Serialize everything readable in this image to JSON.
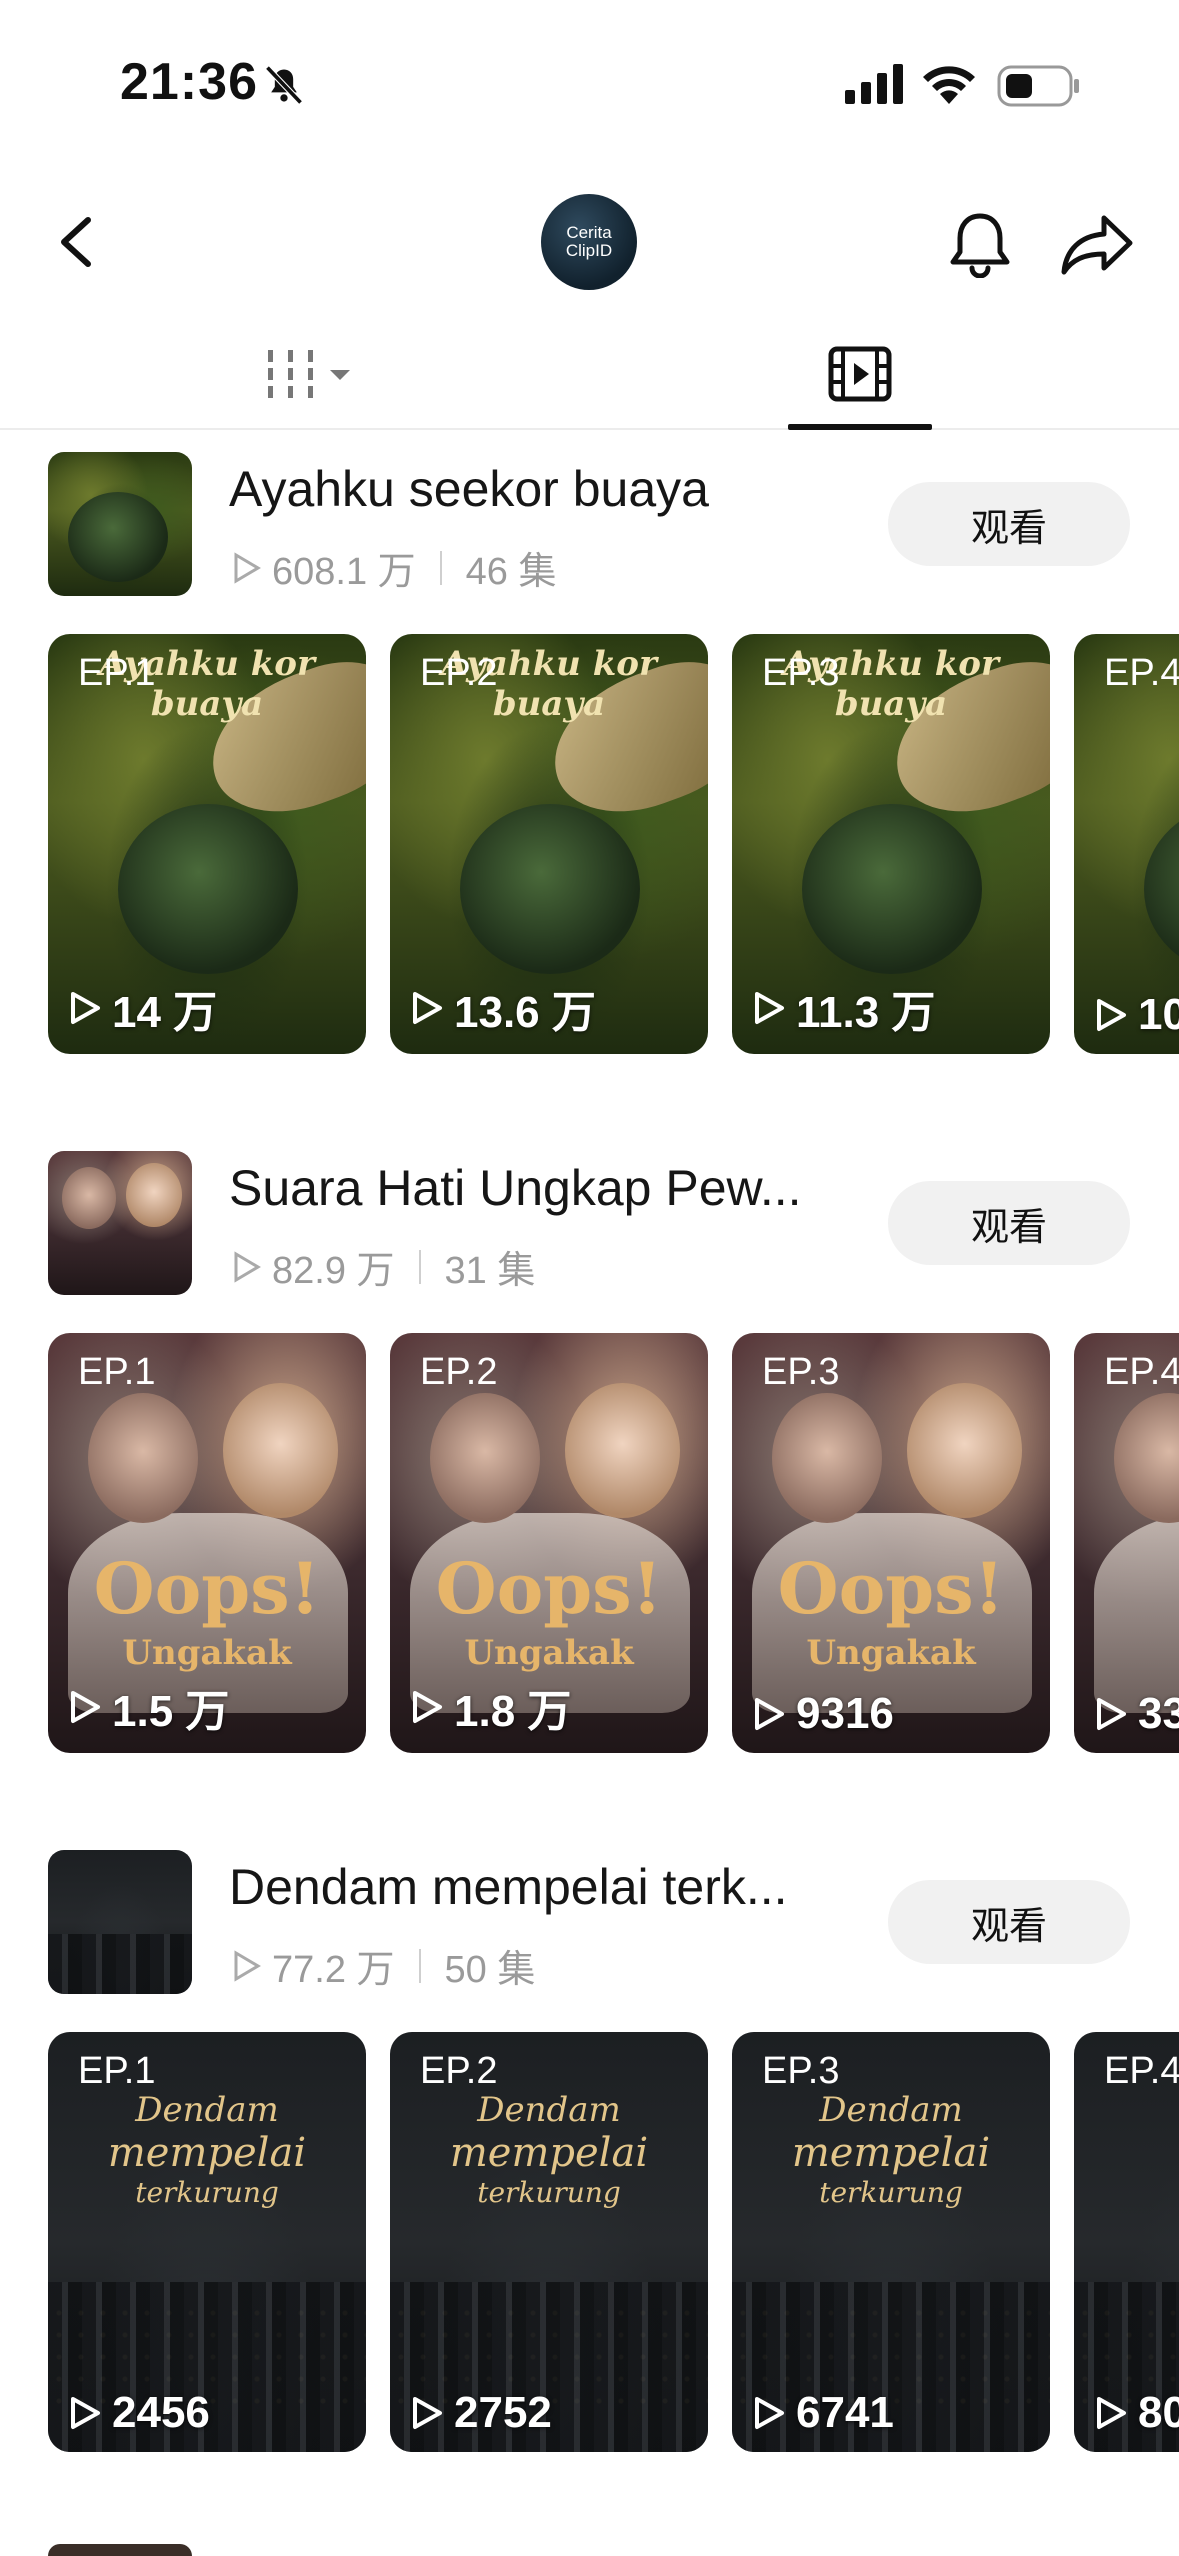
{
  "status_bar": {
    "time": "21:36",
    "icons": [
      "bell-slash-icon",
      "signal-icon",
      "wifi-icon",
      "battery-icon"
    ]
  },
  "header": {
    "avatar_text_1": "Cerita",
    "avatar_text_2": "ClipID",
    "icons": [
      "back-chevron-icon",
      "bell-icon",
      "share-arrow-icon"
    ]
  },
  "tabs": {
    "icons": [
      "grid-bars-icon",
      "dropdown-caret-icon",
      "video-reel-icon"
    ],
    "active": "video"
  },
  "series": [
    {
      "title": "Ayahku seekor buaya",
      "views": "608.1 万",
      "episodes": "46 集",
      "watch_label": "观看",
      "poster_title": "Ayahku kor buaya",
      "episodes_list": [
        {
          "label": "EP.1",
          "views": "14 万"
        },
        {
          "label": "EP.2",
          "views": "13.6 万"
        },
        {
          "label": "EP.3",
          "views": "11.3 万"
        },
        {
          "label": "EP.4",
          "views": "10"
        }
      ]
    },
    {
      "title": "Suara Hati Ungkap Pew...",
      "views": "82.9 万",
      "episodes": "31 集",
      "watch_label": "观看",
      "poster_title": "Oops!",
      "poster_sub": "Ungakak",
      "episodes_list": [
        {
          "label": "EP.1",
          "views": "1.5 万"
        },
        {
          "label": "EP.2",
          "views": "1.8 万"
        },
        {
          "label": "EP.3",
          "views": "9316"
        },
        {
          "label": "EP.4",
          "views": "33"
        }
      ]
    },
    {
      "title": "Dendam mempelai terk...",
      "views": "77.2 万",
      "episodes": "50 集",
      "watch_label": "观看",
      "poster_title_1": "Dendam",
      "poster_title_2": "mempelai",
      "poster_title_3": "terkurung",
      "episodes_list": [
        {
          "label": "EP.1",
          "views": "2456"
        },
        {
          "label": "EP.2",
          "views": "2752"
        },
        {
          "label": "EP.3",
          "views": "6741"
        },
        {
          "label": "EP.4",
          "views": "80"
        }
      ]
    }
  ]
}
